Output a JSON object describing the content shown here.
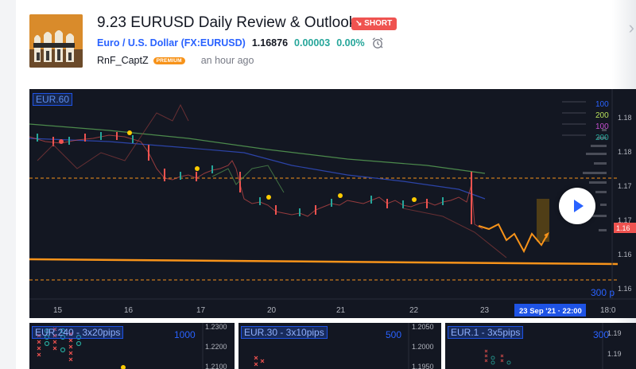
{
  "idea": {
    "title": "9.23 EURUSD Daily Review & Outlook",
    "badge": "SHORT",
    "symbol_name": "Euro / U.S. Dollar",
    "symbol_code": "(FX:EURUSD)",
    "price": "1.16876",
    "change": "0.00003",
    "change_pct": "0.00%",
    "author": "RnF_CaptZ",
    "premium": "PREMIUM",
    "time": "an hour ago"
  },
  "chart": {
    "symbol_tag": "EUR.60",
    "x_ticks": [
      "15",
      "16",
      "17",
      "20",
      "21",
      "22",
      "23",
      "18:0"
    ],
    "price_ticks": [
      "1.18",
      "1.18",
      "1.17",
      "1.17",
      "1.16",
      "1.16"
    ],
    "last_price_label": "1.16",
    "legend": [
      "100",
      "200",
      "100",
      "200"
    ],
    "date_badge": "23 Sep '21 · 22:00",
    "pips_label": "300 p",
    "play_icon": "play-icon"
  },
  "mini_charts": [
    {
      "tag": "EUR.240 - 3x20pips",
      "box": "1000",
      "ticks": [
        "1.2300",
        "1.2200",
        "1.2100"
      ]
    },
    {
      "tag": "EUR.30 - 3x10pips",
      "box": "500",
      "ticks": [
        "1.2050",
        "1.2000",
        "1.1950"
      ]
    },
    {
      "tag": "EUR.1 - 3x5pips",
      "box": "300",
      "ticks": [
        "1.19",
        "1.19"
      ]
    }
  ],
  "colors": {
    "accent": "#2962ff",
    "short": "#ef5350",
    "up": "#26a69a",
    "orange": "#f7931a",
    "chart_bg": "#131722"
  }
}
